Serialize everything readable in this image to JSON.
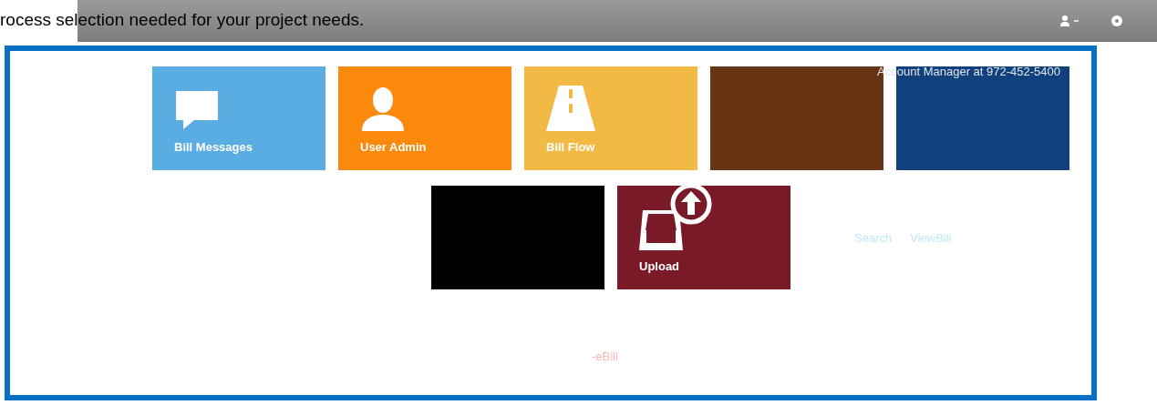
{
  "heading": "rocess selection needed for your project needs.",
  "contact": "Account Manager at 972-452-5400",
  "tile_rows": [
    [
      {
        "kind": "chat",
        "label": "Bill Messages",
        "color": "#5aade2"
      },
      {
        "kind": "user",
        "label": "User Admin",
        "color": "#fb8a0c"
      },
      {
        "kind": "road",
        "label": "Bill Flow",
        "color": "#f2b944"
      },
      {
        "kind": "blank",
        "color": "#673513"
      },
      {
        "kind": "blank",
        "color": "#0f417f"
      }
    ],
    [
      {
        "kind": "blank",
        "color": "#000000"
      },
      {
        "kind": "upload",
        "label": "Upload",
        "color": "#7a1a27"
      }
    ]
  ],
  "links": [
    "Search",
    "ViewBill"
  ],
  "footer_link": "-eBill"
}
